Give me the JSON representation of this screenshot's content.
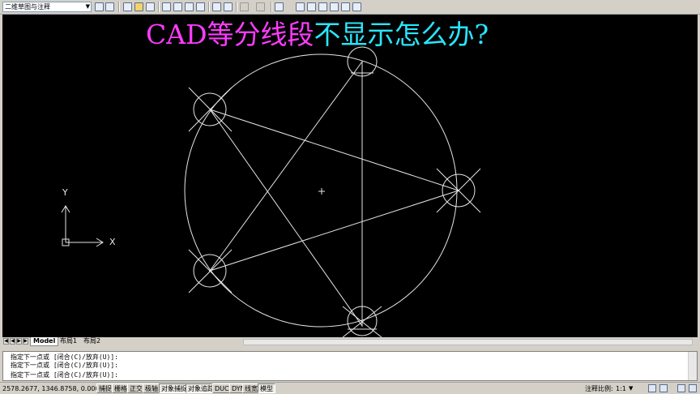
{
  "toolbar": {
    "workspace": "二维草图与注释",
    "icons": [
      "workspace-settings-icon",
      "workspace-icon",
      "new-icon",
      "open-icon",
      "save-icon",
      "print-icon",
      "preview-icon",
      "publish-icon",
      "3d-publish-icon",
      "cut-icon",
      "match-properties-icon",
      "undo-icon",
      "redo-icon",
      "pan-icon",
      "properties-icon",
      "design-center-icon",
      "tool-palettes-icon",
      "sheet-set-icon",
      "markup-icon",
      "calculator-icon"
    ]
  },
  "overlay": {
    "title_part1": "CAD等分线段",
    "title_part2": "不显示怎么办?"
  },
  "ucs": {
    "y_label": "Y",
    "x_label": "X"
  },
  "tabs": {
    "model": "Model",
    "layout1": "布局1",
    "layout2": "布局2"
  },
  "command": {
    "line1": "指定下一点或 [闭合(C)/放弃(U)]:",
    "line2": "指定下一点或 [闭合(C)/放弃(U)]:",
    "line3": "指定下一点或 [闭合(C)/放弃(U)]:"
  },
  "status": {
    "coords": "2578.2677, 1346.8758, 0.0000",
    "buttons": [
      "捕捉",
      "栅格",
      "正交",
      "极轴",
      "对象捕捉",
      "对象追踪",
      "DUCS",
      "DYN",
      "线宽",
      "模型"
    ],
    "annotation_label": "注释比例:",
    "annotation_value": "1:1"
  },
  "colors": {
    "canvas_bg": "#000000",
    "geometry": "#e6e6e6",
    "title_magenta": "#ff3cff",
    "title_cyan": "#28e6ff"
  }
}
